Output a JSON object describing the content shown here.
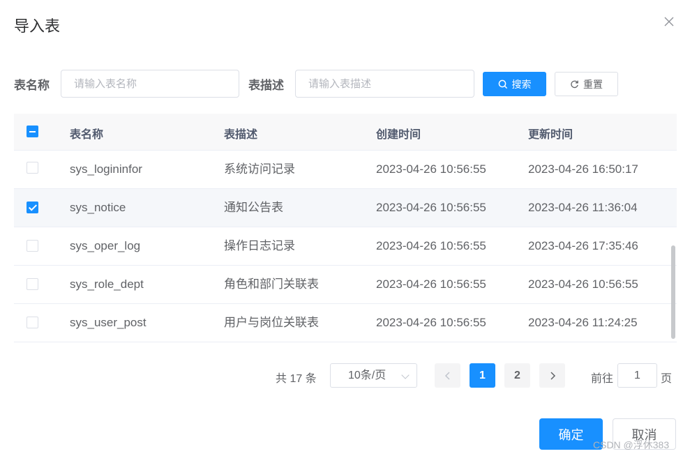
{
  "dialog": {
    "title": "导入表"
  },
  "filters": {
    "name_label": "表名称",
    "name_placeholder": "请输入表名称",
    "desc_label": "表描述",
    "desc_placeholder": "请输入表描述",
    "search_label": "搜索",
    "reset_label": "重置"
  },
  "table": {
    "columns": [
      "表名称",
      "表描述",
      "创建时间",
      "更新时间"
    ],
    "rows": [
      {
        "name": "sys_logininfor",
        "desc": "系统访问记录",
        "created": "2023-04-26 10:56:55",
        "updated": "2023-04-26 16:50:17",
        "checked": false
      },
      {
        "name": "sys_notice",
        "desc": "通知公告表",
        "created": "2023-04-26 10:56:55",
        "updated": "2023-04-26 11:36:04",
        "checked": true
      },
      {
        "name": "sys_oper_log",
        "desc": "操作日志记录",
        "created": "2023-04-26 10:56:55",
        "updated": "2023-04-26 17:35:46",
        "checked": false
      },
      {
        "name": "sys_role_dept",
        "desc": "角色和部门关联表",
        "created": "2023-04-26 10:56:55",
        "updated": "2023-04-26 10:56:55",
        "checked": false
      },
      {
        "name": "sys_user_post",
        "desc": "用户与岗位关联表",
        "created": "2023-04-26 10:56:55",
        "updated": "2023-04-26 11:24:25",
        "checked": false
      }
    ]
  },
  "pagination": {
    "total_text": "共 17 条",
    "page_size": "10条/页",
    "pages": [
      "1",
      "2"
    ],
    "current_page": "1",
    "goto_label": "前往",
    "goto_value": "1",
    "page_suffix": "页"
  },
  "footer": {
    "confirm_label": "确定",
    "cancel_label": "取消"
  },
  "watermark": "CSDN @浮休383",
  "colors": {
    "primary": "#1890ff",
    "header_bg": "#f8f8f9",
    "border": "#dcdfe6"
  }
}
